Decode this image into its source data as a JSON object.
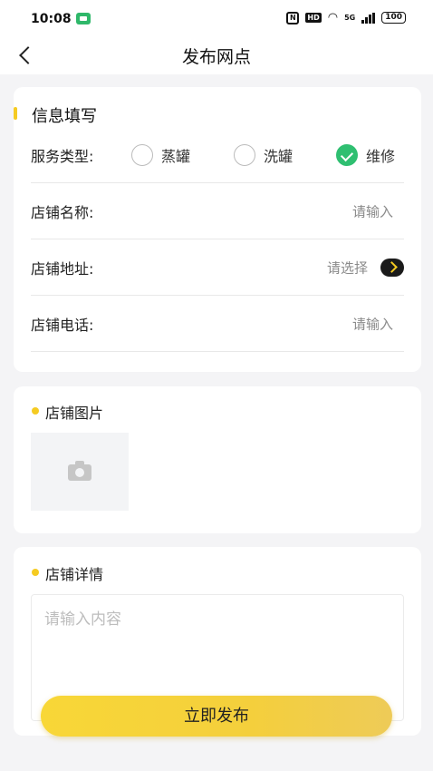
{
  "status_bar": {
    "time": "10:08",
    "nfc": "N",
    "hd": "HD",
    "signal_label": "5G",
    "battery": "100"
  },
  "nav": {
    "title": "发布网点"
  },
  "info_section": {
    "title": "信息填写",
    "service_type": {
      "label": "服务类型:",
      "options": [
        {
          "label": "蒸罐",
          "checked": false
        },
        {
          "label": "洗罐",
          "checked": false
        },
        {
          "label": "维修",
          "checked": true
        }
      ]
    },
    "shop_name": {
      "label": "店铺名称:",
      "placeholder": "请输入"
    },
    "shop_address": {
      "label": "店铺地址:",
      "placeholder": "请选择"
    },
    "shop_phone": {
      "label": "店铺电话:",
      "placeholder": "请输入"
    }
  },
  "photo_section": {
    "title": "店铺图片"
  },
  "detail_section": {
    "title": "店铺详情",
    "placeholder": "请输入内容"
  },
  "submit": {
    "label": "立即发布"
  },
  "colors": {
    "accent": "#f5cb22",
    "check_green": "#2fbf71",
    "background": "#f4f4f6"
  }
}
